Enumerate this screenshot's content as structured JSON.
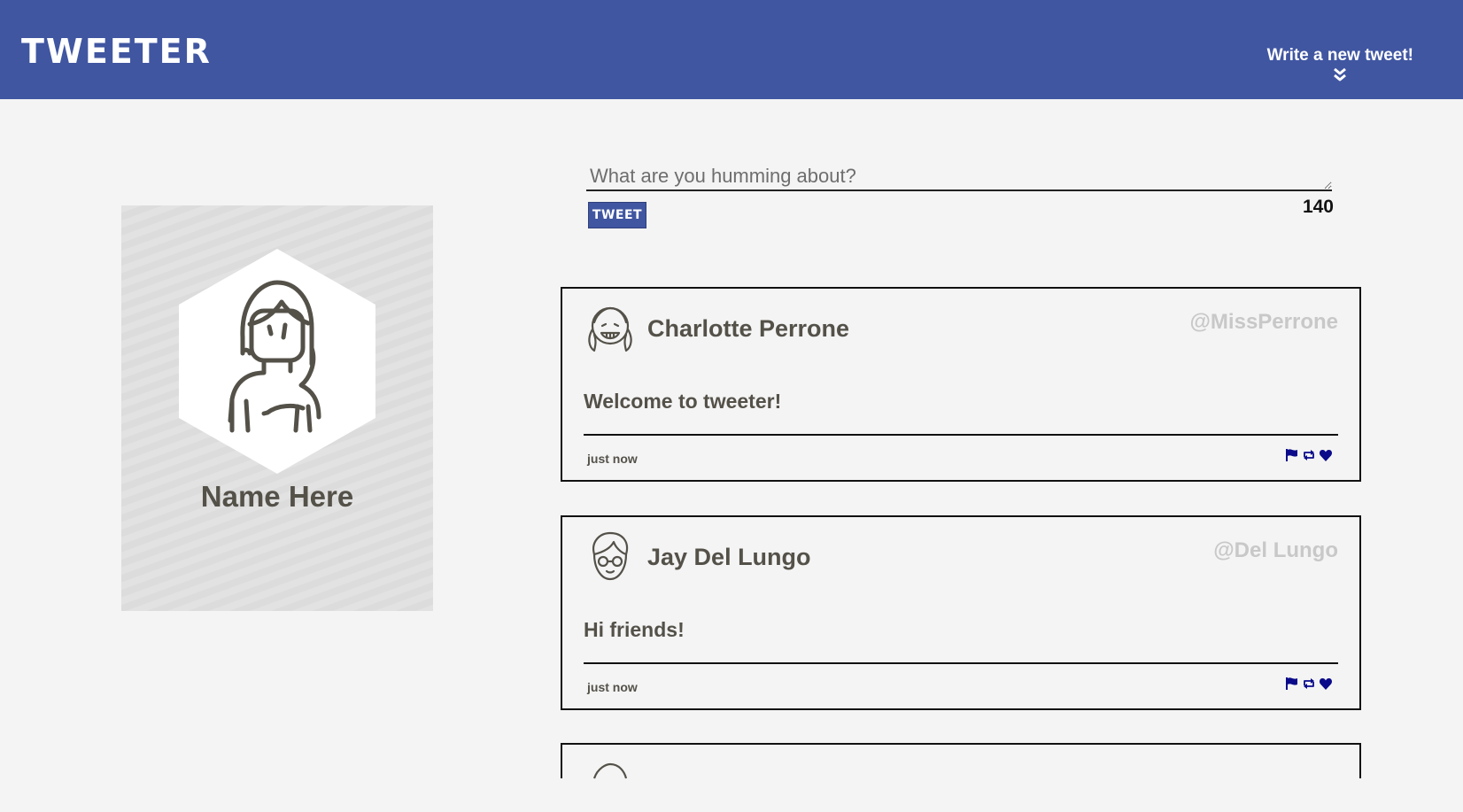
{
  "nav": {
    "logo": "TWEETER",
    "compose_label": "Write a new tweet!",
    "compose_icon": "double-chevron-down-icon",
    "bg_color": "#4056a1"
  },
  "profile": {
    "name": "Name Here",
    "avatar_icon": "woman-avatar-icon"
  },
  "composer": {
    "placeholder": "What are you humming about?",
    "value": "",
    "button_label": "TWEET",
    "char_counter": "140"
  },
  "tweets": [
    {
      "avatar_icon": "smiling-girl-avatar-icon",
      "author": "Charlotte Perrone",
      "handle": "@MissPerrone",
      "content": "Welcome to tweeter!",
      "time": "just now",
      "actions": [
        "flag-icon",
        "retweet-icon",
        "heart-icon"
      ]
    },
    {
      "avatar_icon": "boy-with-glasses-avatar-icon",
      "author": "Jay Del Lungo",
      "handle": "@Del Lungo",
      "content": "Hi friends!",
      "time": "just now",
      "actions": [
        "flag-icon",
        "retweet-icon",
        "heart-icon"
      ]
    }
  ],
  "colors": {
    "accent": "#4056a1",
    "background": "#f4f4f4",
    "text": "#545149",
    "handle": "#c8c8c8",
    "action_icons": "#0a0a8a"
  }
}
